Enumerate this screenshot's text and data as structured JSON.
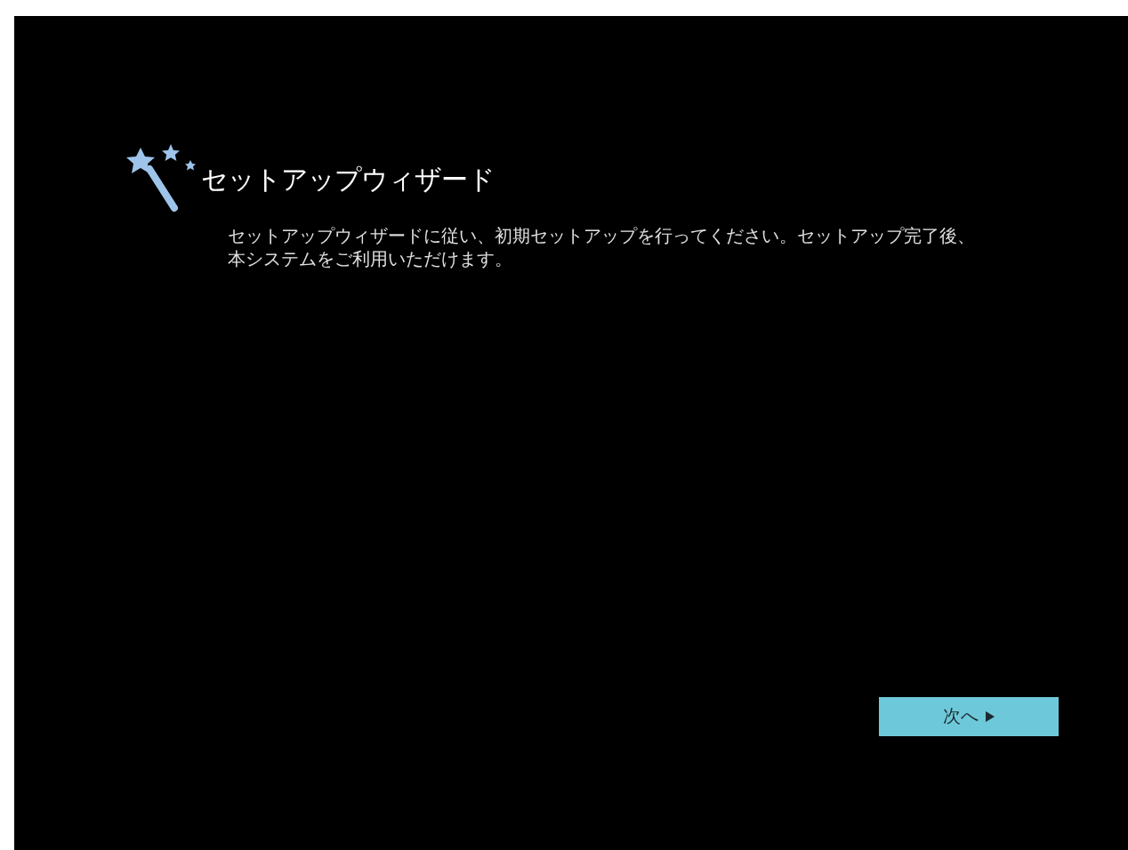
{
  "wizard": {
    "title": "セットアップウィザード",
    "description": "セットアップウィザードに従い、初期セットアップを行ってください。セットアップ完了後、本システムをご利用いただけます。"
  },
  "buttons": [
    {
      "label": "次へ"
    }
  ]
}
